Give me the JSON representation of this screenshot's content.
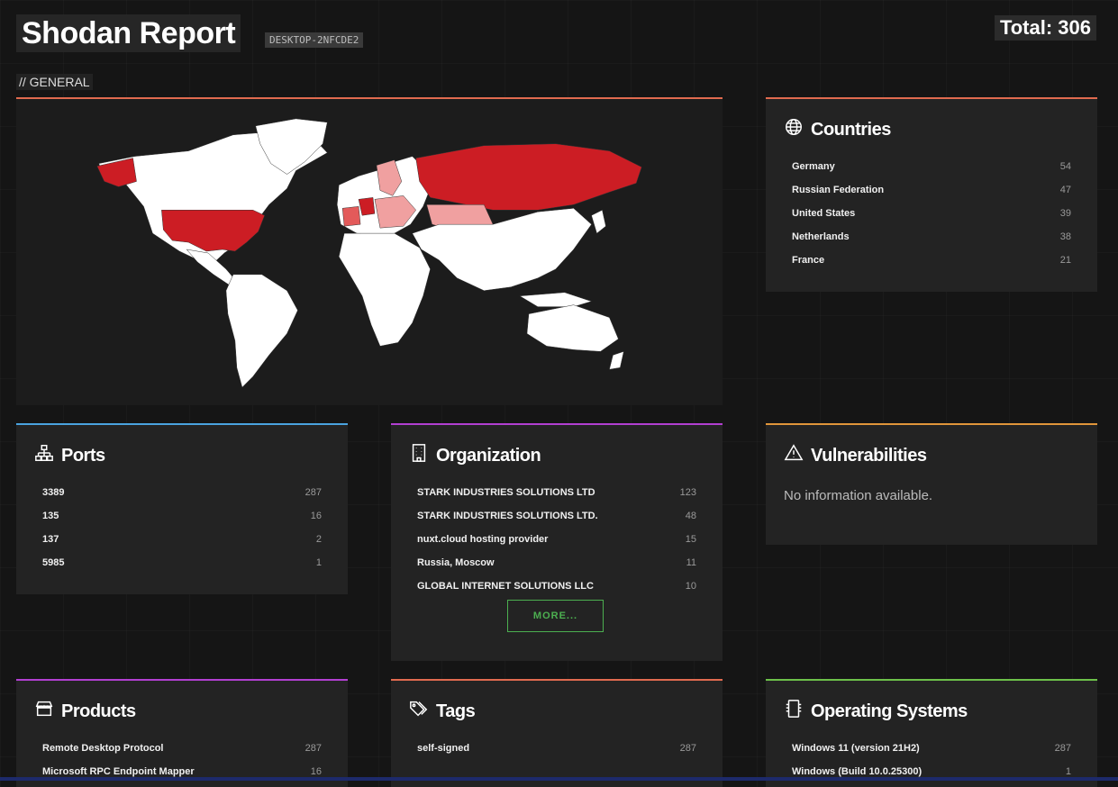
{
  "header": {
    "title": "Shodan Report",
    "hostname": "DESKTOP-2NFCDE2",
    "total": "Total: 306"
  },
  "section_label": "// GENERAL",
  "colors": {
    "map_high": "#cc1d24",
    "map_mid": "#e35a5a",
    "map_low": "#f0a0a0",
    "map_land": "#ffffff",
    "more_button": "#4caf50"
  },
  "countries": {
    "title": "Countries",
    "icon": "globe-icon",
    "items": [
      {
        "label": "Germany",
        "count": "54"
      },
      {
        "label": "Russian Federation",
        "count": "47"
      },
      {
        "label": "United States",
        "count": "39"
      },
      {
        "label": "Netherlands",
        "count": "38"
      },
      {
        "label": "France",
        "count": "21"
      }
    ]
  },
  "ports": {
    "title": "Ports",
    "icon": "network-icon",
    "items": [
      {
        "label": "3389",
        "count": "287"
      },
      {
        "label": "135",
        "count": "16"
      },
      {
        "label": "137",
        "count": "2"
      },
      {
        "label": "5985",
        "count": "1"
      }
    ]
  },
  "organization": {
    "title": "Organization",
    "icon": "building-icon",
    "items": [
      {
        "label": "STARK INDUSTRIES SOLUTIONS LTD",
        "count": "123"
      },
      {
        "label": "STARK INDUSTRIES SOLUTIONS LTD.",
        "count": "48"
      },
      {
        "label": "nuxt.cloud hosting provider",
        "count": "15"
      },
      {
        "label": "Russia, Moscow",
        "count": "11"
      },
      {
        "label": "GLOBAL INTERNET SOLUTIONS LLC",
        "count": "10"
      }
    ],
    "more_label": "MORE..."
  },
  "vulnerabilities": {
    "title": "Vulnerabilities",
    "icon": "warning-icon",
    "message": "No information available."
  },
  "products": {
    "title": "Products",
    "icon": "store-icon",
    "items": [
      {
        "label": "Remote Desktop Protocol",
        "count": "287"
      },
      {
        "label": "Microsoft RPC Endpoint Mapper",
        "count": "16"
      }
    ]
  },
  "tags": {
    "title": "Tags",
    "icon": "tags-icon",
    "items": [
      {
        "label": "self-signed",
        "count": "287"
      }
    ]
  },
  "operating_systems": {
    "title": "Operating Systems",
    "icon": "device-icon",
    "items": [
      {
        "label": "Windows 11 (version 21H2)",
        "count": "287"
      },
      {
        "label": "Windows (Build 10.0.25300)",
        "count": "1"
      }
    ]
  }
}
